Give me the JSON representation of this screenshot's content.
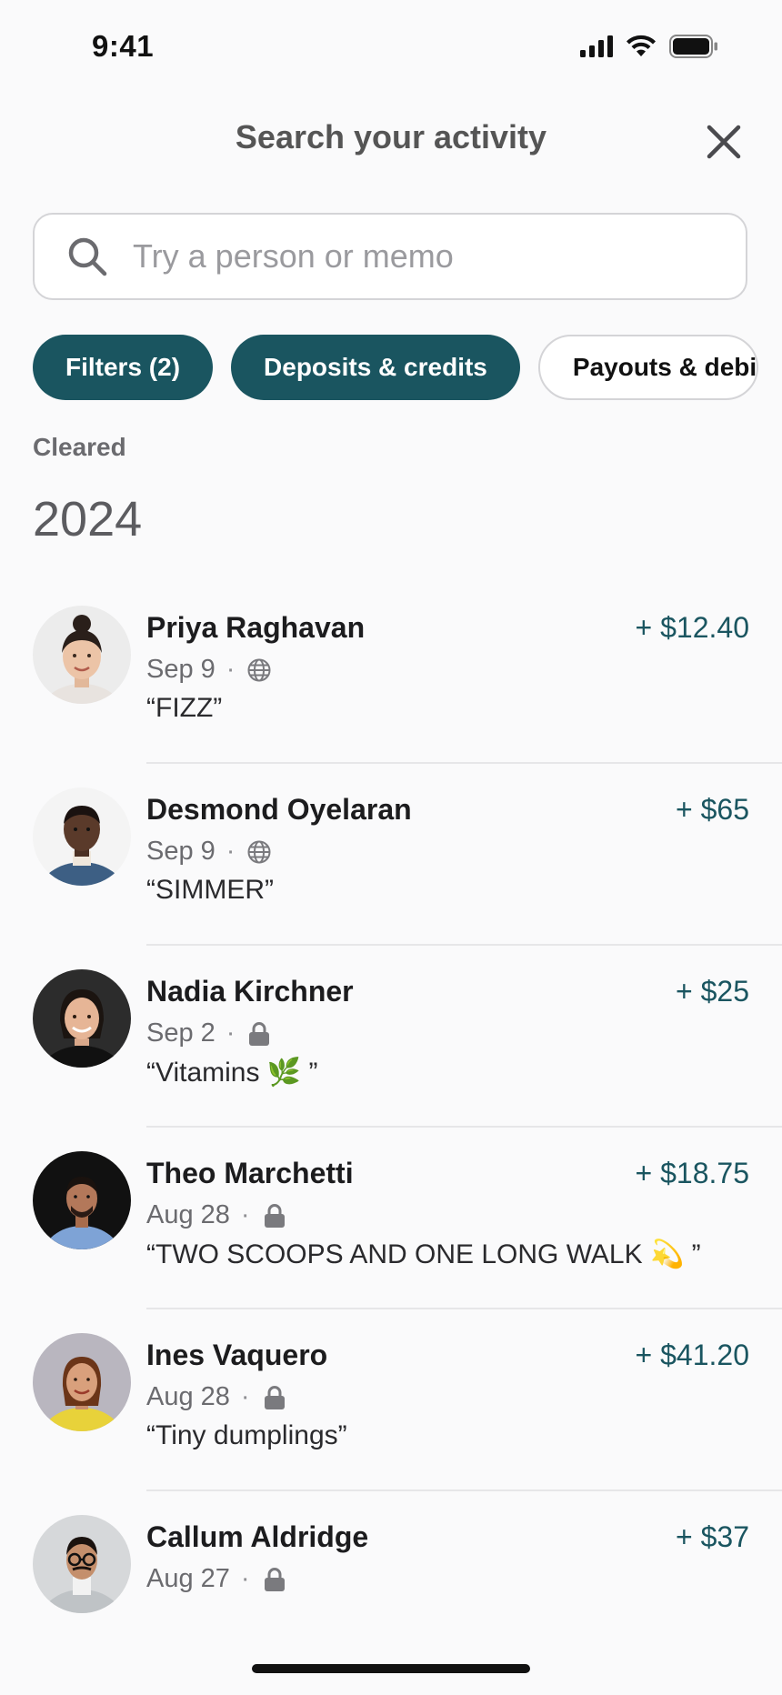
{
  "status_bar": {
    "time": "9:41"
  },
  "header": {
    "title": "Search your activity"
  },
  "search": {
    "placeholder": "Try a person or memo",
    "value": ""
  },
  "chips": [
    {
      "label": "Filters (2)",
      "active": true
    },
    {
      "label": "Deposits & credits",
      "active": true
    },
    {
      "label": "Payouts & debi",
      "active": false
    }
  ],
  "section": {
    "status": "Cleared",
    "year": "2024"
  },
  "colors": {
    "accent": "#1a5560",
    "text": "#1c1c1e",
    "muted": "#6b6b6f"
  },
  "transactions": [
    {
      "name": "Priya Raghavan",
      "amount": "+ $12.40",
      "date": "Sep 9",
      "privacy": "globe-icon",
      "memo": "“FIZZ”"
    },
    {
      "name": "Desmond Oyelaran",
      "amount": "+ $65",
      "date": "Sep 9",
      "privacy": "globe-icon",
      "memo": "“SIMMER”"
    },
    {
      "name": "Nadia Kirchner",
      "amount": "+ $25",
      "date": "Sep 2",
      "privacy": "lock-icon",
      "memo": "“Vitamins 🌿 ”"
    },
    {
      "name": "Theo Marchetti",
      "amount": "+ $18.75",
      "date": "Aug 28",
      "privacy": "lock-icon",
      "memo": "“TWO SCOOPS AND ONE LONG WALK 💫 ”"
    },
    {
      "name": "Ines Vaquero",
      "amount": "+ $41.20",
      "date": "Aug 28",
      "privacy": "lock-icon",
      "memo": "“Tiny dumplings”"
    },
    {
      "name": "Callum Aldridge",
      "amount": "+ $37",
      "date": "Aug 27",
      "privacy": "lock-icon",
      "memo": ""
    }
  ]
}
